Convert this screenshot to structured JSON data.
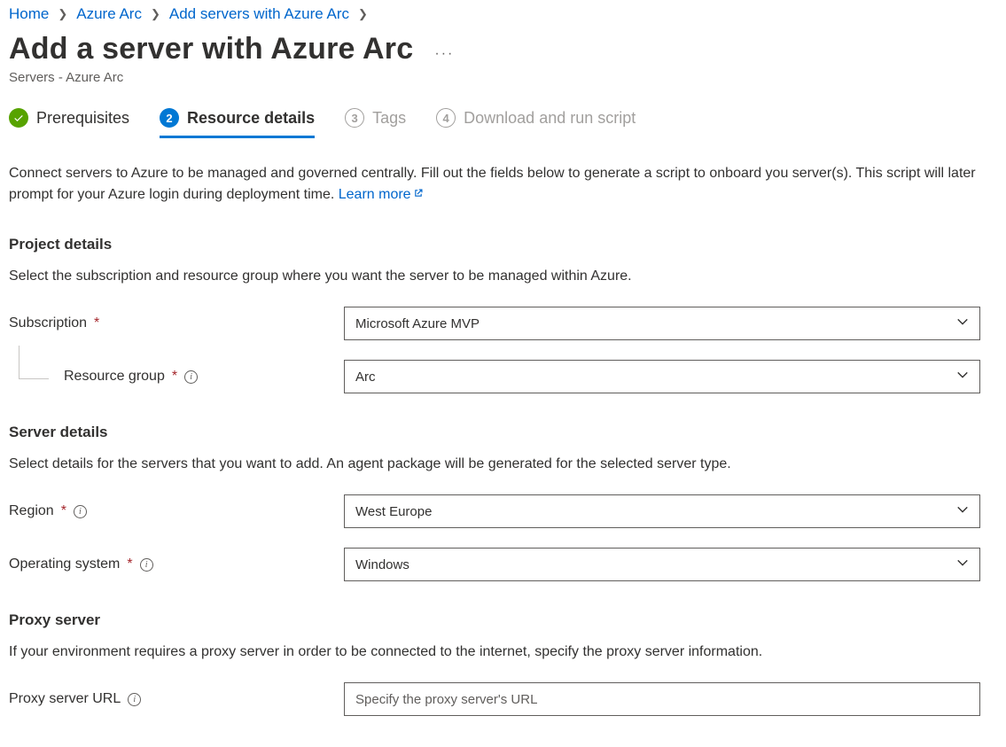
{
  "breadcrumb": [
    {
      "label": "Home"
    },
    {
      "label": "Azure Arc"
    },
    {
      "label": "Add servers with Azure Arc"
    }
  ],
  "title": "Add a server with Azure Arc",
  "subtitle": "Servers - Azure Arc",
  "steps": [
    {
      "label": "Prerequisites",
      "state": "completed"
    },
    {
      "num": "2",
      "label": "Resource details",
      "state": "active"
    },
    {
      "num": "3",
      "label": "Tags",
      "state": "todo"
    },
    {
      "num": "4",
      "label": "Download and run script",
      "state": "todo"
    }
  ],
  "intro_text": "Connect servers to Azure to be managed and governed centrally. Fill out the fields below to generate a script to onboard you server(s). This script will later prompt for your Azure login during deployment time. ",
  "learn_more_label": "Learn more",
  "sections": {
    "project": {
      "title": "Project details",
      "desc": "Select the subscription and resource group where you want the server to be managed within Azure.",
      "subscription_label": "Subscription",
      "subscription_value": "Microsoft Azure MVP",
      "resource_group_label": "Resource group",
      "resource_group_value": "Arc"
    },
    "server": {
      "title": "Server details",
      "desc": "Select details for the servers that you want to add. An agent package will be generated for the selected server type.",
      "region_label": "Region",
      "region_value": "West Europe",
      "os_label": "Operating system",
      "os_value": "Windows"
    },
    "proxy": {
      "title": "Proxy server",
      "desc": "If your environment requires a proxy server in order to be connected to the internet, specify the proxy server information.",
      "url_label": "Proxy server URL",
      "url_placeholder": "Specify the proxy server's URL"
    }
  }
}
